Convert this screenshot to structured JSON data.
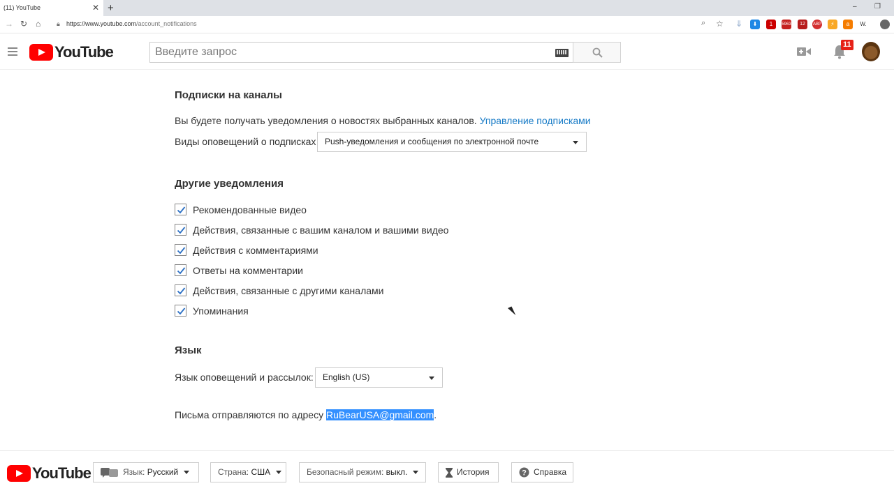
{
  "browser": {
    "tab_title": "(11) YouTube",
    "tab_close": "✕",
    "new_tab": "+",
    "url_host": "https://www.youtube.com",
    "url_path": "/account_notifications",
    "window_minimize": "–",
    "window_restore": "❐",
    "extensions": [
      {
        "name": "red-badge",
        "text": "1",
        "color": "#cc0000"
      },
      {
        "name": "gmail",
        "text": "5963",
        "color": "#c5221f"
      },
      {
        "name": "calendar",
        "text": "12",
        "color": "#b71c1c"
      },
      {
        "name": "adblock",
        "text": "ABP",
        "color": "#d32f2f"
      }
    ]
  },
  "header": {
    "logo_text": "YouTube",
    "search_placeholder": "Введите запрос",
    "notification_count": "11"
  },
  "subscriptions": {
    "title": "Подписки на каналы",
    "description": "Вы будете получать уведомления о новостях выбранных каналов.",
    "manage_link": "Управление подписками",
    "alert_type_label": "Виды оповещений о подписках",
    "alert_type_value": "Push-уведомления и сообщения по электронной почте"
  },
  "other": {
    "title": "Другие уведомления",
    "items": [
      {
        "label": "Рекомендованные видео",
        "checked": true
      },
      {
        "label": "Действия, связанные с вашим каналом и вашими видео",
        "checked": true
      },
      {
        "label": "Действия с комментариями",
        "checked": true
      },
      {
        "label": "Ответы на комментарии",
        "checked": true
      },
      {
        "label": "Действия, связанные с другими каналами",
        "checked": true
      },
      {
        "label": "Упоминания",
        "checked": true
      }
    ]
  },
  "language": {
    "title": "Язык",
    "label": "Язык оповещений и рассылок:",
    "value": "English (US)"
  },
  "email": {
    "prefix": "Письма отправляются по адресу",
    "address": "RuBearUSA@gmail.com",
    "suffix": "."
  },
  "footer": {
    "logo_text": "YouTube",
    "language_label": "Язык:",
    "language_value": "Русский",
    "country_label": "Страна:",
    "country_value": "США",
    "safe_label": "Безопасный режим:",
    "safe_value": "выкл.",
    "history": "История",
    "help": "Справка"
  }
}
